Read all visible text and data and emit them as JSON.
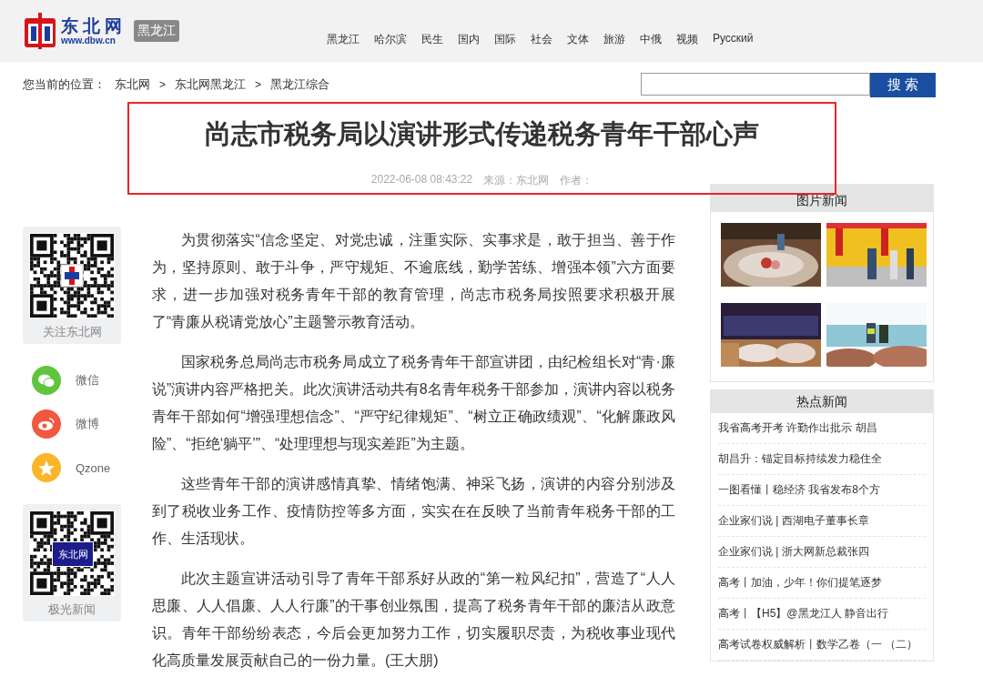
{
  "header": {
    "logo": {
      "name": "东北网",
      "url": "www.dbw.cn",
      "region": "黑龙江"
    },
    "nav": [
      "黑龙江",
      "哈尔滨",
      "民生",
      "国内",
      "国际",
      "社会",
      "文体",
      "旅游",
      "中俄",
      "视频",
      "Русский"
    ]
  },
  "breadcrumb": {
    "label": "您当前的位置：",
    "separator": ">",
    "items": [
      "东北网",
      "东北网黑龙江",
      "黑龙江综合"
    ]
  },
  "search": {
    "button": "搜 索"
  },
  "article": {
    "title": "尚志市税务局以演讲形式传递税务青年干部心声",
    "date": "2022-06-08 08:43:22",
    "source": "来源：东北网",
    "author": "作者：",
    "paragraphs": [
      "为贯彻落实“信念坚定、对党忠诚，注重实际、实事求是，敢于担当、善于作为，坚持原则、敢于斗争，严守规矩、不逾底线，勤学苦练、增强本领”六方面要求，进一步加强对税务青年干部的教育管理，尚志市税务局按照要求积极开展了“青廉从税请党放心”主题警示教育活动。",
      "国家税务总局尚志市税务局成立了税务青年干部宣讲团，由纪检组长对“青·廉说”演讲内容严格把关。此次演讲活动共有8名青年税务干部参加，演讲内容以税务青年干部如何“增强理想信念”、“严守纪律规矩”、“树立正确政绩观”、“化解廉政风险”、“拒绝‘躺平’”、“处理理想与现实差距”为主题。",
      "这些青年干部的演讲感情真挚、情绪饱满、神采飞扬，演讲的内容分别涉及到了税收业务工作、疫情防控等多方面，实实在在反映了当前青年税务干部的工作、生活现状。",
      "此次主题宣讲活动引导了青年干部系好从政的“第一粒风纪扣”，营造了“人人思廉、人人倡廉、人人行廉”的干事创业氛围，提高了税务青年干部的廉洁从政意识。青年干部纷纷表态，今后会更加努力工作，切实履职尽责，为税收事业现代化高质量发展贡献自己的一份力量。(王大朋)"
    ]
  },
  "left_panel": {
    "qr_top": {
      "caption": "关注东北网"
    },
    "share": [
      {
        "kind": "wechat",
        "label": "微信",
        "color": "#5fc63b"
      },
      {
        "kind": "weibo",
        "label": "微博",
        "color": "#f1583f"
      },
      {
        "kind": "qzone",
        "label": "Qzone",
        "color": "#fbb529"
      }
    ],
    "qr_bottom": {
      "caption": "极光新闻",
      "badge": "东北网"
    }
  },
  "sidebar": {
    "photo_news": {
      "title": "图片新闻"
    },
    "hot_news": {
      "title": "热点新闻",
      "items": [
        "我省高考开考 许勤作出批示 胡昌",
        "胡昌升：锚定目标持续发力稳住全",
        "一图看懂丨稳经济 我省发布8个方",
        "企业家们说 | 西湖电子董事长章",
        "企业家们说 | 浙大网新总裁张四",
        "高考丨加油，少年！你们提笔逐梦",
        "高考丨【H5】@黑龙江人 静音出行",
        "高考试卷权威解析丨数学乙卷（一 （二）"
      ]
    }
  }
}
